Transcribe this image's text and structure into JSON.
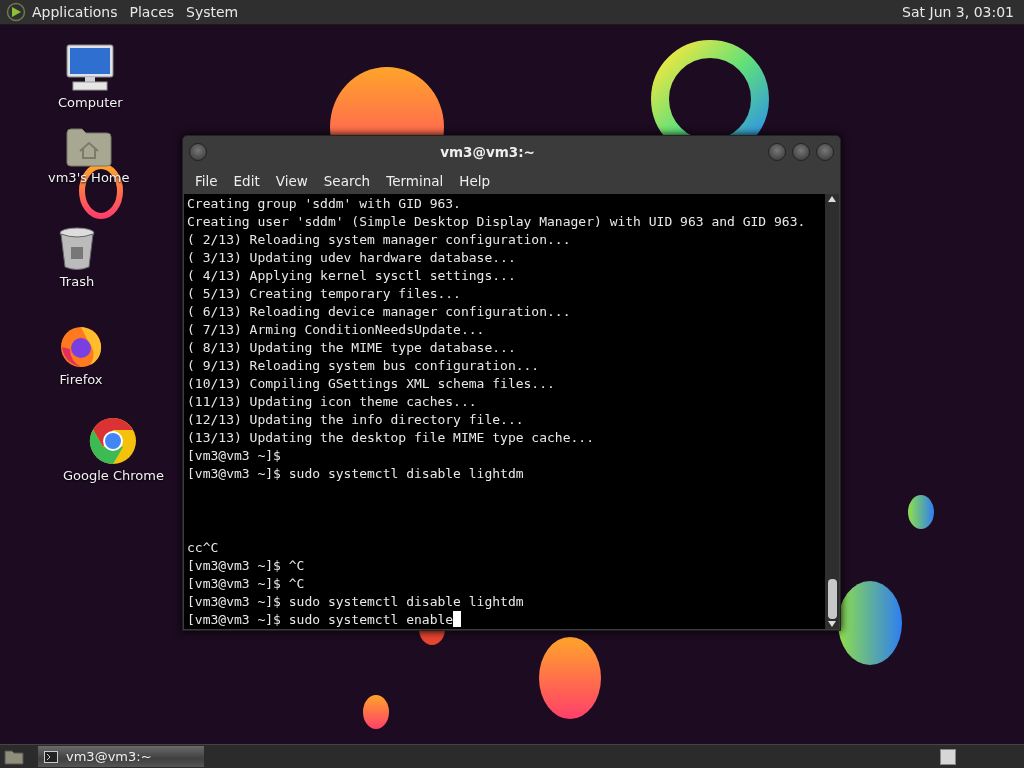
{
  "top_panel": {
    "menus": [
      "Applications",
      "Places",
      "System"
    ],
    "clock": "Sat Jun  3, 03:01"
  },
  "desktop_icons": [
    {
      "kind": "computer",
      "label": "Computer"
    },
    {
      "kind": "home",
      "label": "vm3's Home"
    },
    {
      "kind": "trash",
      "label": "Trash"
    },
    {
      "kind": "firefox",
      "label": "Firefox"
    },
    {
      "kind": "chrome",
      "label": "Google Chrome"
    }
  ],
  "terminal": {
    "title": "vm3@vm3:~",
    "menu": [
      "File",
      "Edit",
      "View",
      "Search",
      "Terminal",
      "Help"
    ],
    "upper_lines": [
      "Creating group 'sddm' with GID 963.",
      "Creating user 'sddm' (Simple Desktop Display Manager) with UID 963 and GID 963.",
      "( 2/13) Reloading system manager configuration...",
      "( 3/13) Updating udev hardware database...",
      "( 4/13) Applying kernel sysctl settings...",
      "( 5/13) Creating temporary files...",
      "( 6/13) Reloading device manager configuration...",
      "( 7/13) Arming ConditionNeedsUpdate...",
      "( 8/13) Updating the MIME type database...",
      "( 9/13) Reloading system bus configuration...",
      "(10/13) Compiling GSettings XML schema files...",
      "(11/13) Updating icon theme caches...",
      "(12/13) Updating the info directory file...",
      "(13/13) Updating the desktop file MIME type cache...",
      "[vm3@vm3 ~]$",
      "[vm3@vm3 ~]$ sudo systemctl disable lightdm"
    ],
    "lower_lines": [
      "cc^C",
      "[vm3@vm3 ~]$ ^C",
      "[vm3@vm3 ~]$ ^C",
      "[vm3@vm3 ~]$ sudo systemctl disable lightdm",
      "[vm3@vm3 ~]$ sudo systemctl enable"
    ]
  },
  "taskbar": {
    "tasks": [
      {
        "label": "vm3@vm3:~",
        "selected": true
      }
    ]
  }
}
